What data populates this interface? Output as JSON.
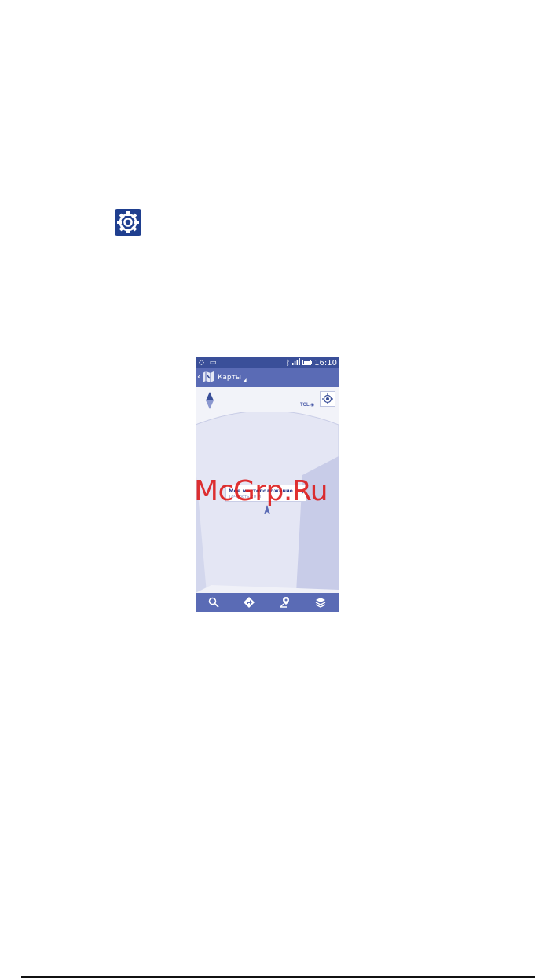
{
  "page": {
    "section_icon": "settings-gear-icon",
    "watermark": "McGrp.Ru"
  },
  "phone": {
    "status_bar": {
      "left_icons": [
        "notification-diamond-icon",
        "notification-image-icon"
      ],
      "right_icons": [
        "bluetooth-icon",
        "signal-icon",
        "battery-icon"
      ],
      "time": "16:10"
    },
    "action_bar": {
      "back_icon": "chevron-left-icon",
      "logo_icon": "maps-logo-icon",
      "title": "Карты"
    },
    "map": {
      "compass_icon": "compass-icon",
      "locate_icon": "my-location-icon",
      "tcl_label": "TCL",
      "callout": {
        "title": "Мое местоположение",
        "subtitle": "Точность 20 м"
      }
    },
    "bottom_bar": {
      "buttons": [
        "search-icon",
        "directions-icon",
        "places-icon",
        "layers-icon"
      ]
    }
  },
  "colors": {
    "status_bar": "#3a4f99",
    "action_bar": "#5a6bb5",
    "accent": "#1f3f8f",
    "watermark": "#dc1414"
  }
}
